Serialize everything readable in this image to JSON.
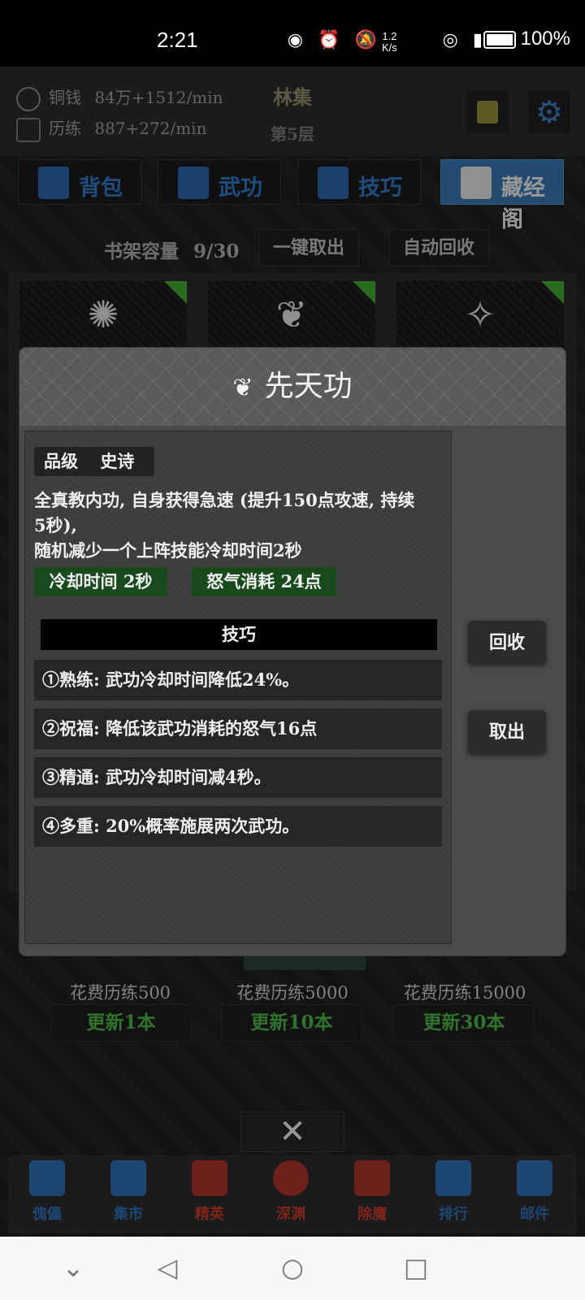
{
  "status_bar": {
    "time": "2:21",
    "net_speed_value": "1.2",
    "net_speed_unit": "K/s",
    "battery": "100%",
    "icons": [
      "eye-icon",
      "alarm-icon",
      "mute-icon",
      "hotspot-icon",
      "signal-icon"
    ]
  },
  "header": {
    "copper_label": "铜钱",
    "copper_value": "84万+1512/min",
    "exp_label": "历练",
    "exp_value": "887+272/min",
    "location": "林集",
    "floor": "第5层"
  },
  "tabs": [
    {
      "label": "背包",
      "active": false
    },
    {
      "label": "武功",
      "active": false
    },
    {
      "label": "技巧",
      "active": false
    },
    {
      "label": "藏经阁",
      "active": true
    }
  ],
  "shelf": {
    "capacity_label": "书架容量",
    "capacity_value": "9/30",
    "take_all_label": "一键取出",
    "auto_recycle_label": "自动回收"
  },
  "cards": [
    {
      "icon": "sun-emblem-icon",
      "glyph": "✺"
    },
    {
      "icon": "wings-emblem-icon",
      "glyph": "❦"
    },
    {
      "icon": "stars-icon",
      "glyph": "✧"
    }
  ],
  "refresh": [
    {
      "cost": "花费历练500",
      "label": "更新1本"
    },
    {
      "cost": "花费历练5000",
      "label": "更新10本"
    },
    {
      "cost": "花费历练15000",
      "label": "更新30本"
    }
  ],
  "bottom_nav": [
    {
      "label": "傀儡",
      "color": "#2d6bb0"
    },
    {
      "label": "集市",
      "color": "#2d6bb0"
    },
    {
      "label": "精英",
      "color": "#c0392b"
    },
    {
      "label": "深渊",
      "color": "#c0392b"
    },
    {
      "label": "除魔",
      "color": "#c0392b"
    },
    {
      "label": "排行",
      "color": "#2d6bb0"
    },
    {
      "label": "邮件",
      "color": "#2d6bb0"
    }
  ],
  "modal": {
    "title": "先天功",
    "grade_label": "品级",
    "grade_value": "史诗",
    "description_line1": "全真教内功, 自身获得急速 (提升150点攻速, 持续",
    "description_line2": "5秒),",
    "description_line3": "随机减少一个上阵技能冷却时间2秒",
    "cooldown_tag": "冷却时间 2秒",
    "rage_tag": "怒气消耗 24点",
    "section_title": "技巧",
    "skills": [
      "①熟练: 武功冷却时间降低24%。",
      "②祝福: 降低该武功消耗的怒气16点",
      "③精通: 武功冷却时间减4秒。",
      "④多重: 20%概率施展两次武功。"
    ],
    "recycle_label": "回收",
    "take_out_label": "取出"
  },
  "colors": {
    "accent_blue": "#3773ad",
    "green_text": "#4cb148",
    "tag_green": "#194a1d"
  }
}
